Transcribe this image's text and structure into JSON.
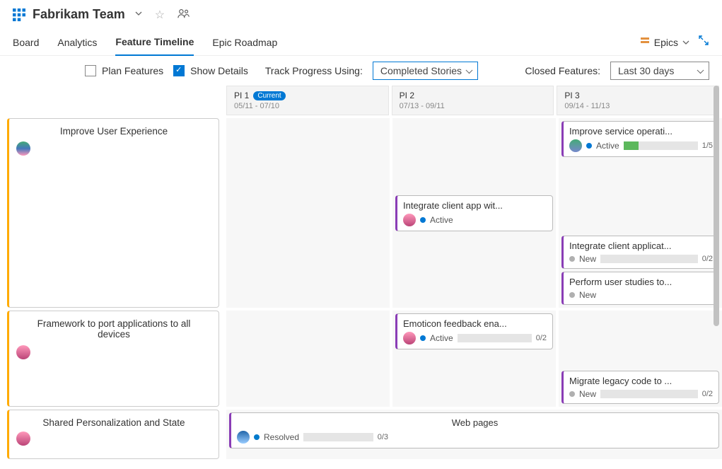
{
  "header": {
    "team_name": "Fabrikam Team"
  },
  "tabs": {
    "board": "Board",
    "analytics": "Analytics",
    "feature_timeline": "Feature Timeline",
    "epic_roadmap": "Epic Roadmap",
    "epics_label": "Epics"
  },
  "filters": {
    "plan_features": "Plan Features",
    "show_details": "Show Details",
    "track_label": "Track Progress Using:",
    "track_value": "Completed Stories",
    "closed_label": "Closed Features:",
    "closed_value": "Last 30 days"
  },
  "columns": [
    {
      "name": "PI 1",
      "badge": "Current",
      "dates": "05/11 - 07/10"
    },
    {
      "name": "PI 2",
      "badge": "",
      "dates": "07/13 - 09/11"
    },
    {
      "name": "PI 3",
      "badge": "",
      "dates": "09/14 - 11/13"
    }
  ],
  "epics": [
    {
      "title": "Improve User Experience"
    },
    {
      "title": "Framework to port applications to all devices"
    },
    {
      "title": "Shared Personalization and State"
    }
  ],
  "cards": {
    "e1_p2_a": {
      "title": "Integrate client app wit...",
      "state": "Active"
    },
    "e1_p3_a": {
      "title": "Improve service operati...",
      "state": "Active",
      "progress_text": "1/5",
      "progress_pct": 20
    },
    "e1_p3_b": {
      "title": "Integrate client applicat...",
      "state": "New",
      "progress_text": "0/2",
      "progress_pct": 0
    },
    "e1_p3_c": {
      "title": "Perform user studies to...",
      "state": "New"
    },
    "e2_p2_a": {
      "title": "Emoticon feedback ena...",
      "state": "Active",
      "progress_text": "0/2",
      "progress_pct": 0
    },
    "e2_p3_a": {
      "title": "Migrate legacy code to ...",
      "state": "New",
      "progress_text": "0/2",
      "progress_pct": 0
    },
    "e3_wide": {
      "title": "Web pages",
      "state": "Resolved",
      "progress_text": "0/3",
      "progress_pct": 0
    }
  }
}
